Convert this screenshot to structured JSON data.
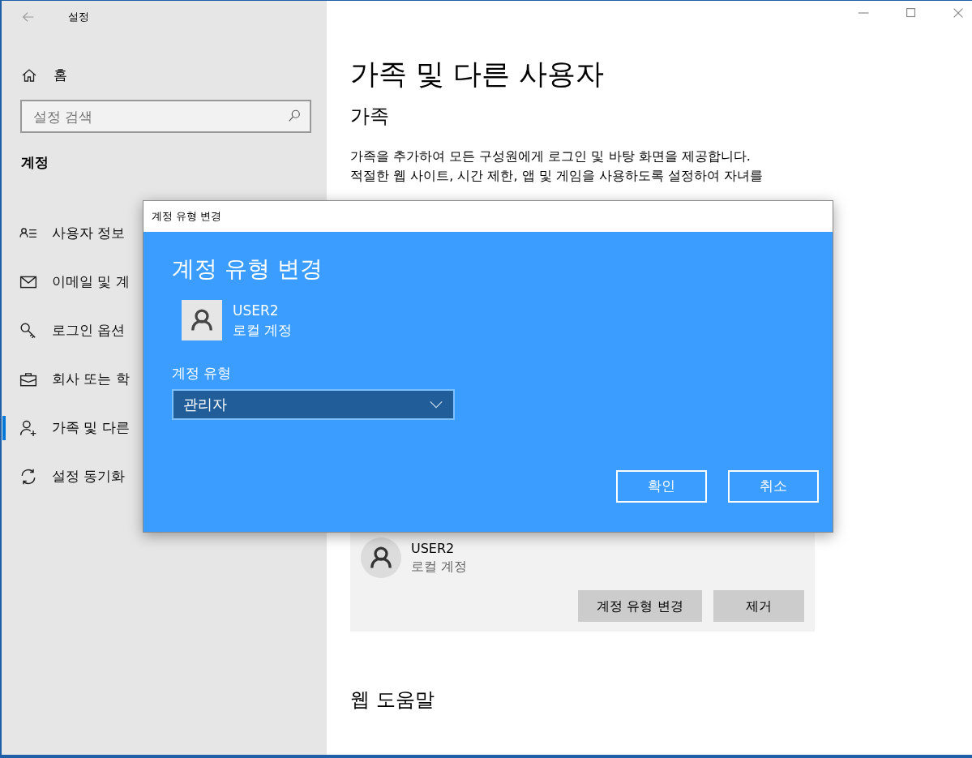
{
  "window": {
    "title": "설정"
  },
  "sidebar": {
    "home": "홈",
    "search": {
      "placeholder": "설정 검색"
    },
    "section": "계정",
    "items": [
      {
        "label": "사용자 정보",
        "selected": false
      },
      {
        "label": "이메일 및 계",
        "selected": false
      },
      {
        "label": "로그인 옵션",
        "selected": false
      },
      {
        "label": "회사 또는 학",
        "selected": false
      },
      {
        "label": "가족 및 다른",
        "selected": true
      },
      {
        "label": "설정 동기화",
        "selected": false
      }
    ]
  },
  "main": {
    "title": "가족 및 다른 사용자",
    "family": {
      "heading": "가족",
      "description_lines": [
        "가족을 추가하여 모든 구성원에게 로그인 및 바탕 화면을 제공합니다.",
        "적절한 웹 사이트, 시간 제한, 앱 및 게임을 사용하도록 설정하여 자녀를"
      ]
    },
    "other_user": {
      "name": "USER2",
      "type": "로컬 계정",
      "buttons": [
        "계정 유형 변경",
        "제거"
      ]
    },
    "help": {
      "heading": "웹 도움말"
    }
  },
  "dialog": {
    "title": "계정 유형 변경",
    "heading": "계정 유형 변경",
    "user": {
      "name": "USER2",
      "type": "로컬 계정"
    },
    "field_label": "계정 유형",
    "value": "관리자",
    "buttons": [
      "확인",
      "취소"
    ]
  }
}
